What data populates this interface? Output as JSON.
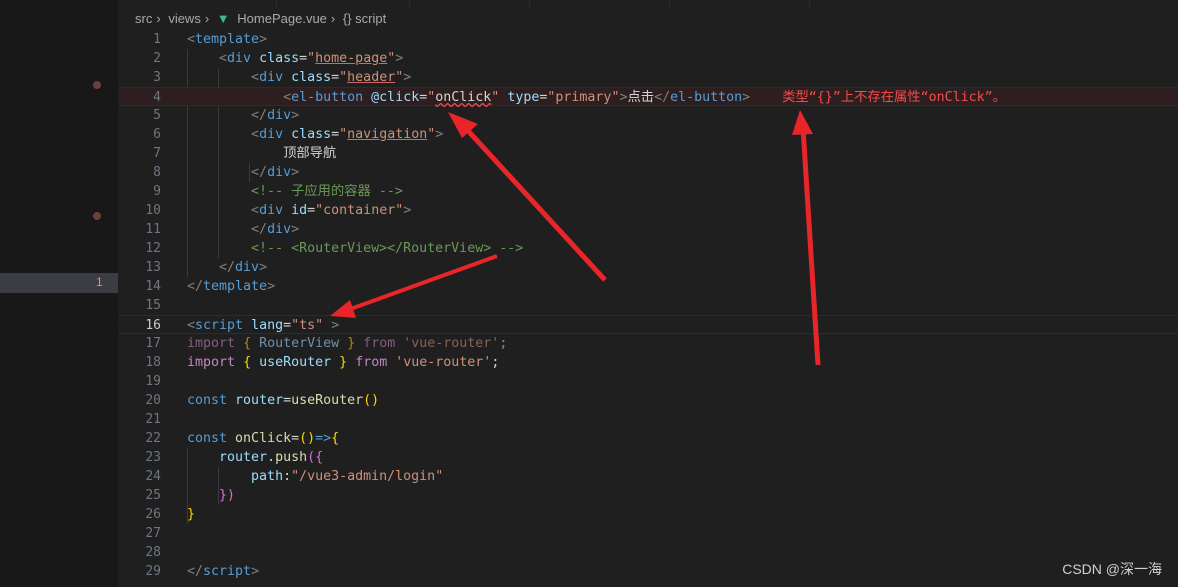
{
  "breadcrumb": {
    "part1": "src",
    "part2": "views",
    "file": "HomePage.vue",
    "symbol": "{} script"
  },
  "gutter": {
    "problem_count": "1"
  },
  "lines": [
    {
      "n": "1"
    },
    {
      "n": "2"
    },
    {
      "n": "3"
    },
    {
      "n": "4"
    },
    {
      "n": "5"
    },
    {
      "n": "6"
    },
    {
      "n": "7"
    },
    {
      "n": "8"
    },
    {
      "n": "9"
    },
    {
      "n": "10"
    },
    {
      "n": "11"
    },
    {
      "n": "12"
    },
    {
      "n": "13"
    },
    {
      "n": "14"
    },
    {
      "n": "15"
    },
    {
      "n": "16"
    },
    {
      "n": "17"
    },
    {
      "n": "18"
    },
    {
      "n": "19"
    },
    {
      "n": "20"
    },
    {
      "n": "21"
    },
    {
      "n": "22"
    },
    {
      "n": "23"
    },
    {
      "n": "24"
    },
    {
      "n": "25"
    },
    {
      "n": "26"
    },
    {
      "n": "27"
    },
    {
      "n": "28"
    },
    {
      "n": "29"
    }
  ],
  "code": {
    "l1_tag": "template",
    "l2_tag": "div",
    "l2_attr": "class",
    "l2_val": "home-page",
    "l3_tag": "div",
    "l3_attr": "class",
    "l3_val": "header",
    "l4_tag": "el-button",
    "l4_attr1": "@click",
    "l4_val1": "onClick",
    "l4_attr2": "type",
    "l4_val2": "primary",
    "l4_text": "点击",
    "l4_close": "el-button",
    "l4_error": "类型“{}”上不存在属性“onClick”。",
    "l5_close": "div",
    "l6_tag": "div",
    "l6_attr": "class",
    "l6_val": "navigation",
    "l7_text": "顶部导航",
    "l8_close": "div",
    "l9_comment": "<!-- 子应用的容器 -->",
    "l10_tag": "div",
    "l10_attr": "id",
    "l10_val": "container",
    "l11_close": "div",
    "l12_comment": "<!-- <RouterView></RouterView> -->",
    "l13_close": "div",
    "l14_close": "template",
    "l16_tag": "script",
    "l16_attr": "lang",
    "l16_val": "ts",
    "l17_import": "import",
    "l17_name": "RouterView",
    "l17_from": "from",
    "l17_src": "'vue-router'",
    "l18_import": "import",
    "l18_name": "useRouter",
    "l18_from": "from",
    "l18_src": "'vue-router'",
    "l20_const": "const",
    "l20_var": "router",
    "l20_fn": "useRouter",
    "l22_const": "const",
    "l22_var": "onClick",
    "l23_obj": "router",
    "l23_method": "push",
    "l24_key": "path",
    "l24_val": "\"/vue3-admin/login\"",
    "l29_close": "script"
  },
  "watermark": "CSDN @深一海",
  "colors": {
    "background": "#1f1f1f",
    "error": "#f14c4c",
    "arrow": "#e8262a"
  }
}
